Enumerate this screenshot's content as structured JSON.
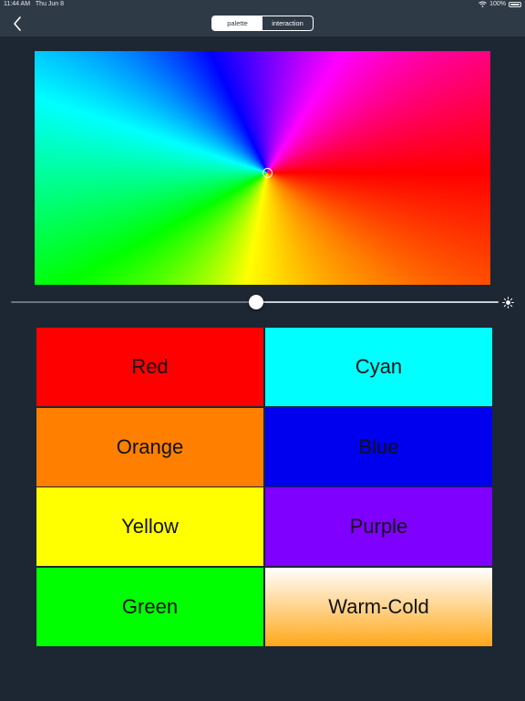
{
  "status_bar": {
    "time": "11:44 AM",
    "date": "Thu Jun 8",
    "battery": "100%"
  },
  "navbar": {
    "segments": [
      {
        "label": "palette",
        "active": true
      },
      {
        "label": "interaction",
        "active": false
      }
    ]
  },
  "brightness_slider": {
    "value": 0.5
  },
  "swatches": [
    {
      "label": "Red",
      "color": "#ff0000"
    },
    {
      "label": "Cyan",
      "color": "#00ffff"
    },
    {
      "label": "Orange",
      "color": "#ff8000"
    },
    {
      "label": "Blue",
      "color": "#0000ee"
    },
    {
      "label": "Yellow",
      "color": "#ffff00"
    },
    {
      "label": "Purple",
      "color": "#8000ff"
    },
    {
      "label": "Green",
      "color": "#00ff00"
    },
    {
      "label": "Warm-Cold",
      "color": "linear-gradient(to bottom, #ffffff, #ffa81a)"
    }
  ],
  "colors": {
    "background": "#1c2733",
    "navbar": "#2e3a46"
  }
}
